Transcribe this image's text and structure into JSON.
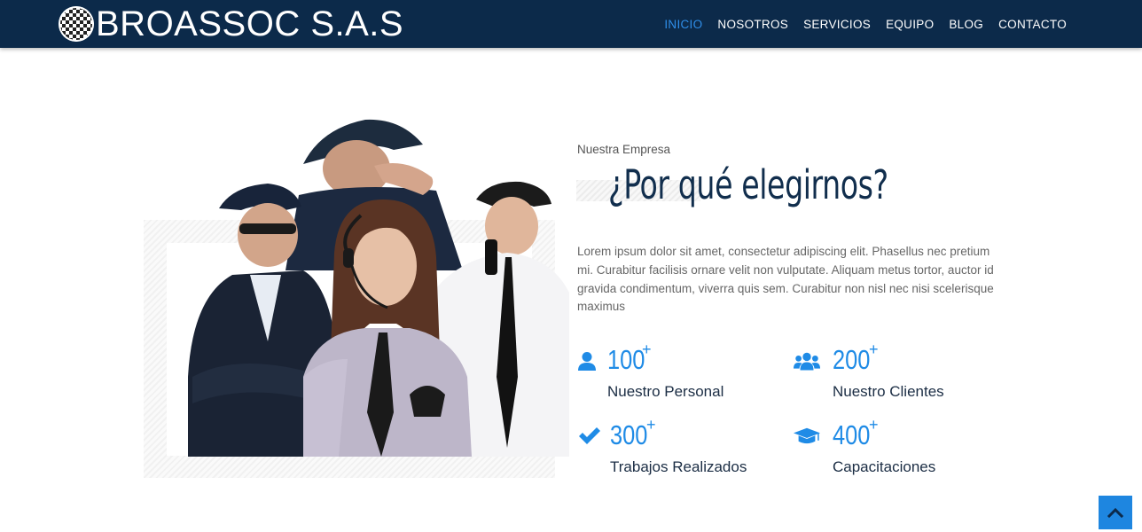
{
  "header": {
    "brand": "BROASSOC S.A.S",
    "nav": [
      {
        "label": "INICIO",
        "active": true
      },
      {
        "label": "NOSOTROS",
        "active": false
      },
      {
        "label": "SERVICIOS",
        "active": false
      },
      {
        "label": "EQUIPO",
        "active": false
      },
      {
        "label": "BLOG",
        "active": false
      },
      {
        "label": "CONTACTO",
        "active": false
      }
    ]
  },
  "about": {
    "eyebrow": "Nuestra Empresa",
    "title": "¿Por qué elegirnos?",
    "paragraph": "Lorem ipsum dolor sit amet, consectetur adipiscing elit. Phasellus nec pretium mi. Curabitur facilisis ornare velit non vulputate. Aliquam metus tortor, auctor id gravida condimentum, viverra quis sem. Curabitur non nisl nec nisi scelerisque maximus",
    "stats": [
      {
        "icon": "user-icon",
        "number": "100",
        "plus": "+",
        "label": "Nuestro Personal"
      },
      {
        "icon": "users-icon",
        "number": "200",
        "plus": "+",
        "label": "Nuestro Clientes"
      },
      {
        "icon": "check-icon",
        "number": "300",
        "plus": "+",
        "label": "Trabajos Realizados"
      },
      {
        "icon": "graduation-cap-icon",
        "number": "400",
        "plus": "+",
        "label": "Capacitaciones"
      }
    ]
  },
  "scroll_top": {
    "icon": "chevron-up-icon"
  },
  "colors": {
    "navbar": "#0c2a4a",
    "accent": "#1f8be6",
    "heading": "#112e4d",
    "active_nav": "#2f8ee8"
  }
}
